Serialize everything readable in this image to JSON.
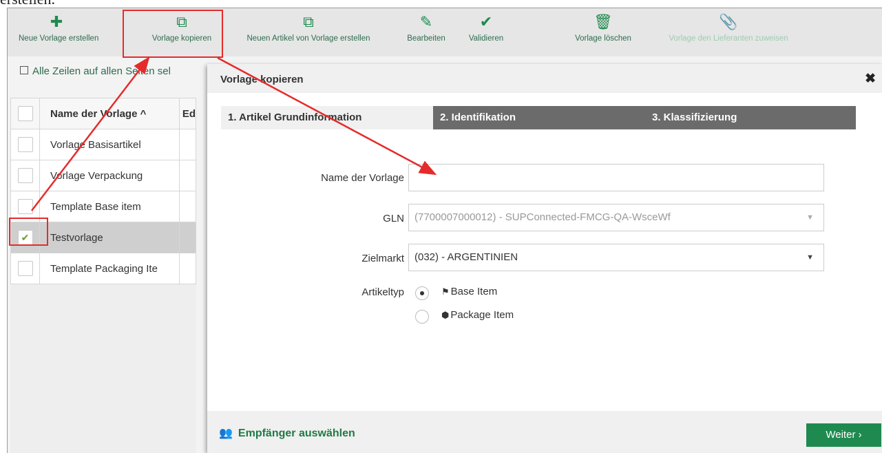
{
  "caption": "erstellen.",
  "toolbar": {
    "new_template": "Neue Vorlage erstellen",
    "copy_template": "Vorlage kopieren",
    "new_item_from_template": "Neuen Artikel von Vorlage erstellen",
    "edit": "Bearbeiten",
    "validate": "Validieren",
    "delete_template": "Vorlage löschen",
    "assign_supplier": "Vorlage den Lieferanten zuweisen"
  },
  "select_all": "Alle Zeilen auf allen Seiten sel",
  "grid": {
    "header_name": "Name der Vorlage ^",
    "header_next": "Ed",
    "rows": [
      {
        "name": "Vorlage Basisartikel",
        "checked": false
      },
      {
        "name": "Vorlage Verpackung",
        "checked": false
      },
      {
        "name": "Template Base item",
        "checked": false
      },
      {
        "name": "Testvorlage",
        "checked": true
      },
      {
        "name": "Template Packaging Ite",
        "checked": false
      }
    ]
  },
  "modal": {
    "title": "Vorlage kopieren",
    "close": "✖",
    "tabs": [
      "1. Artikel Grundinformation",
      "2. Identifikation",
      "3. Klassifizierung"
    ],
    "fields": {
      "name_label": "Name der Vorlage",
      "name_value": "",
      "gln_label": "GLN",
      "gln_value": "(7700007000012) - SUPConnected-FMCG-QA-WsceWf",
      "market_label": "Zielmarkt",
      "market_value": "(032) - ARGENTINIEN",
      "type_label": "Artikeltyp",
      "type_options": [
        "Base Item",
        "Package Item"
      ],
      "type_selected": "Base Item"
    },
    "footer": {
      "recipients": "Empfänger auswählen",
      "next": "Weiter ›"
    }
  },
  "colors": {
    "accent_green": "#1f8a4f",
    "annotation_red": "#e52b2b",
    "tab_inactive": "#6b6b6b"
  }
}
